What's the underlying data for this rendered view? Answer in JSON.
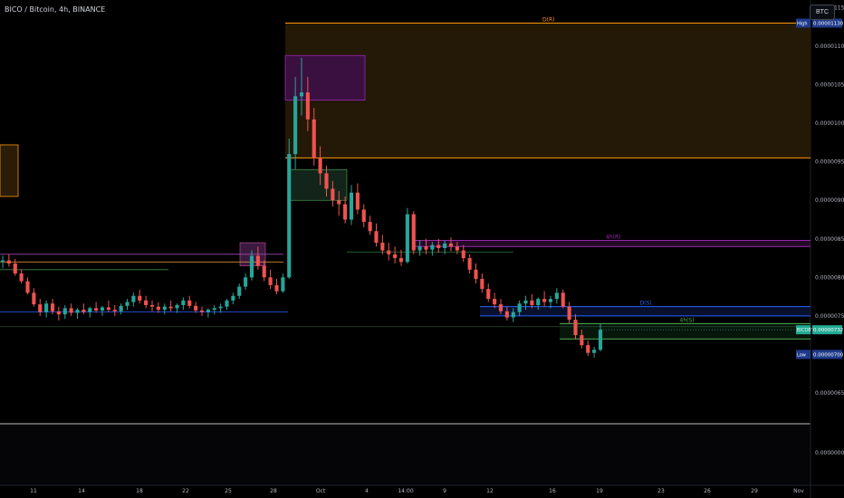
{
  "header": {
    "title": "BICO / Bitcoin, 4h, BINANCE",
    "currency": "BTC"
  },
  "colors": {
    "up": "#26a69a",
    "down": "#ef5350",
    "bull_fill": "#1f3d2b",
    "supply": "#ff9800",
    "supply_fill": "#2a1c07",
    "purple": "#9c27b0",
    "blue": "#2962ff",
    "green": "#4caf50",
    "price_tag": "#22ab94",
    "axis_text": "#b2b5be",
    "background": "#000000"
  },
  "chart_data": {
    "type": "candlestick",
    "y_axis": {
      "ylim": [
        6.1e-06,
        1.16e-05
      ],
      "tick_labels": [
        "0.00001150",
        "0.00001100",
        "0.00001050",
        "0.00001000",
        "0.00000950",
        "0.00000900",
        "0.00000850",
        "0.00000800",
        "0.00000750",
        "0.00000650"
      ]
    },
    "x_axis": {
      "tick_labels": [
        "11",
        "14",
        "18",
        "22",
        "25",
        "28",
        "Oct",
        "4",
        "14:00",
        "9",
        "12",
        "16",
        "19",
        "23",
        "26",
        "29",
        "Nov"
      ]
    },
    "price_labels": [
      {
        "text": "High",
        "value": "0.00001130"
      },
      {
        "text": "BICOBTC",
        "value": "0.00000732"
      },
      {
        "text": "Low",
        "value": "0.00000700"
      }
    ],
    "zone_labels": [
      "D(R)",
      "4h(R)",
      "D(S)",
      "4h(S)"
    ],
    "indicator_pane": {
      "tick_label": "0.00000000"
    },
    "ohlc": [
      [
        8.2,
        8.28,
        8.12,
        8.22
      ],
      [
        8.22,
        8.3,
        8.14,
        8.18
      ],
      [
        8.18,
        8.24,
        8.02,
        8.05
      ],
      [
        8.05,
        8.1,
        7.92,
        7.95
      ],
      [
        7.95,
        8.0,
        7.78,
        7.8
      ],
      [
        7.8,
        7.86,
        7.62,
        7.65
      ],
      [
        7.65,
        7.72,
        7.5,
        7.55
      ],
      [
        7.55,
        7.7,
        7.48,
        7.66
      ],
      [
        7.66,
        7.72,
        7.52,
        7.56
      ],
      [
        7.56,
        7.62,
        7.44,
        7.52
      ],
      [
        7.52,
        7.64,
        7.46,
        7.6
      ],
      [
        7.6,
        7.66,
        7.5,
        7.54
      ],
      [
        7.54,
        7.6,
        7.46,
        7.58
      ],
      [
        7.58,
        7.66,
        7.52,
        7.55
      ],
      [
        7.55,
        7.62,
        7.48,
        7.6
      ],
      [
        7.6,
        7.68,
        7.54,
        7.57
      ],
      [
        7.57,
        7.63,
        7.5,
        7.61
      ],
      [
        7.61,
        7.7,
        7.55,
        7.58
      ],
      [
        7.58,
        7.64,
        7.5,
        7.56
      ],
      [
        7.56,
        7.66,
        7.52,
        7.63
      ],
      [
        7.63,
        7.72,
        7.58,
        7.68
      ],
      [
        7.68,
        7.8,
        7.62,
        7.76
      ],
      [
        7.76,
        7.84,
        7.66,
        7.7
      ],
      [
        7.7,
        7.76,
        7.6,
        7.64
      ],
      [
        7.64,
        7.7,
        7.56,
        7.62
      ],
      [
        7.62,
        7.68,
        7.54,
        7.58
      ],
      [
        7.58,
        7.66,
        7.52,
        7.62
      ],
      [
        7.62,
        7.7,
        7.56,
        7.6
      ],
      [
        7.6,
        7.66,
        7.54,
        7.64
      ],
      [
        7.64,
        7.74,
        7.58,
        7.7
      ],
      [
        7.7,
        7.76,
        7.6,
        7.63
      ],
      [
        7.63,
        7.68,
        7.54,
        7.57
      ],
      [
        7.57,
        7.62,
        7.5,
        7.55
      ],
      [
        7.55,
        7.6,
        7.48,
        7.58
      ],
      [
        7.58,
        7.64,
        7.52,
        7.6
      ],
      [
        7.6,
        7.66,
        7.54,
        7.62
      ],
      [
        7.62,
        7.72,
        7.58,
        7.7
      ],
      [
        7.7,
        7.8,
        7.65,
        7.76
      ],
      [
        7.76,
        7.92,
        7.72,
        7.88
      ],
      [
        7.88,
        8.05,
        7.84,
        8.0
      ],
      [
        8.0,
        8.35,
        7.96,
        8.28
      ],
      [
        8.28,
        8.4,
        8.1,
        8.15
      ],
      [
        8.15,
        8.22,
        7.95,
        8.0
      ],
      [
        8.0,
        8.1,
        7.85,
        7.9
      ],
      [
        7.9,
        7.98,
        7.78,
        7.82
      ],
      [
        7.82,
        8.05,
        7.8,
        8.0
      ],
      [
        8.0,
        9.8,
        7.98,
        9.6
      ],
      [
        9.6,
        10.6,
        9.4,
        10.35
      ],
      [
        10.35,
        10.85,
        10.1,
        10.4
      ],
      [
        10.4,
        10.6,
        9.9,
        10.05
      ],
      [
        10.05,
        10.2,
        9.45,
        9.55
      ],
      [
        9.55,
        9.7,
        9.2,
        9.35
      ],
      [
        9.35,
        9.45,
        9.05,
        9.15
      ],
      [
        9.15,
        9.25,
        8.92,
        9.0
      ],
      [
        9.0,
        9.12,
        8.8,
        8.95
      ],
      [
        8.95,
        9.05,
        8.7,
        8.75
      ],
      [
        8.75,
        9.2,
        8.68,
        9.1
      ],
      [
        9.1,
        9.22,
        8.82,
        8.88
      ],
      [
        8.88,
        8.95,
        8.65,
        8.72
      ],
      [
        8.72,
        8.8,
        8.55,
        8.6
      ],
      [
        8.6,
        8.7,
        8.4,
        8.45
      ],
      [
        8.45,
        8.55,
        8.3,
        8.35
      ],
      [
        8.35,
        8.45,
        8.22,
        8.3
      ],
      [
        8.3,
        8.4,
        8.18,
        8.25
      ],
      [
        8.25,
        8.36,
        8.15,
        8.2
      ],
      [
        8.2,
        8.9,
        8.18,
        8.82
      ],
      [
        8.82,
        8.86,
        8.3,
        8.35
      ],
      [
        8.35,
        8.48,
        8.28,
        8.4
      ],
      [
        8.4,
        8.5,
        8.3,
        8.36
      ],
      [
        8.36,
        8.46,
        8.28,
        8.42
      ],
      [
        8.42,
        8.5,
        8.32,
        8.38
      ],
      [
        8.38,
        8.48,
        8.3,
        8.44
      ],
      [
        8.44,
        8.52,
        8.34,
        8.4
      ],
      [
        8.4,
        8.46,
        8.3,
        8.35
      ],
      [
        8.35,
        8.42,
        8.2,
        8.25
      ],
      [
        8.25,
        8.3,
        8.05,
        8.1
      ],
      [
        8.1,
        8.18,
        7.92,
        7.98
      ],
      [
        7.98,
        8.05,
        7.8,
        7.85
      ],
      [
        7.85,
        7.92,
        7.68,
        7.72
      ],
      [
        7.72,
        7.8,
        7.6,
        7.65
      ],
      [
        7.65,
        7.72,
        7.52,
        7.56
      ],
      [
        7.56,
        7.62,
        7.44,
        7.48
      ],
      [
        7.48,
        7.6,
        7.42,
        7.55
      ],
      [
        7.55,
        7.7,
        7.5,
        7.66
      ],
      [
        7.66,
        7.76,
        7.58,
        7.7
      ],
      [
        7.7,
        7.78,
        7.6,
        7.64
      ],
      [
        7.64,
        7.74,
        7.58,
        7.72
      ],
      [
        7.72,
        7.82,
        7.62,
        7.68
      ],
      [
        7.68,
        7.76,
        7.6,
        7.72
      ],
      [
        7.72,
        7.86,
        7.66,
        7.8
      ],
      [
        7.8,
        7.84,
        7.6,
        7.62
      ],
      [
        7.62,
        7.68,
        7.4,
        7.45
      ],
      [
        7.45,
        7.52,
        7.2,
        7.25
      ],
      [
        7.25,
        7.32,
        7.08,
        7.12
      ],
      [
        7.12,
        7.18,
        6.98,
        7.02
      ],
      [
        7.02,
        7.1,
        6.96,
        7.06
      ],
      [
        7.06,
        7.4,
        7.04,
        7.32
      ]
    ],
    "zones": [
      {
        "label": "D(R)",
        "top": 11.3,
        "bottom": 9.55,
        "kind": "supply"
      },
      {
        "label": "4h(R)",
        "top": 8.48,
        "bottom": 8.4,
        "kind": "purple"
      },
      {
        "label": "D(S)",
        "top": 7.62,
        "bottom": 7.5,
        "kind": "blue"
      },
      {
        "label": "4h(S)",
        "top": 7.4,
        "bottom": 7.2,
        "kind": "green"
      }
    ]
  }
}
